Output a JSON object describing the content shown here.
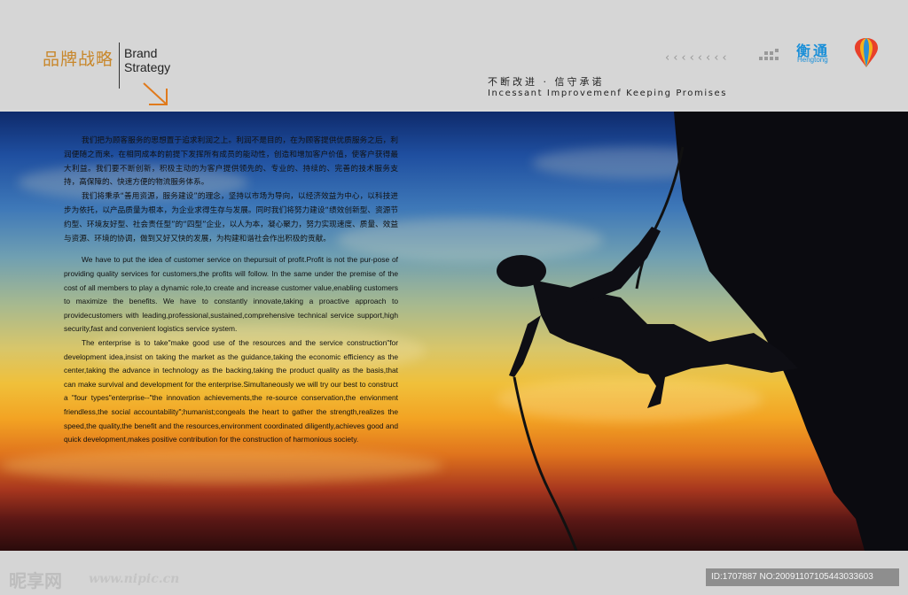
{
  "header": {
    "brand_cn": "品牌战略",
    "brand_en_line1": "Brand",
    "brand_en_line2": "Strategy",
    "chevrons": "‹‹‹‹‹‹‹‹",
    "logo_cn": "衡通",
    "logo_en": "Hengtong",
    "slogan_cn": "不断改进 · 信守承诺",
    "slogan_en": "Incessant Improvemenf Keeping Promises",
    "brand_color": "#c8872b",
    "logo_color": "#1a8fd8"
  },
  "body": {
    "paragraphs_cn": [
      "我们把为顾客服务的思想置于追求利润之上。利润不是目的，在为顾客提供优质服务之后，利润便随之而来。在相同成本的前提下发挥所有成员的能动性，创造和增加客户价值，使客户获得最大利益。我们要不断创新，积极主动的为客户提供领先的、专业的、持续的、完善的技术服务支持，高保障的、快速方便的物流服务体系。",
      "我们将秉承“善用资源，服务建设”的理念，坚持以市场为导向，以经济效益为中心，以科技进步为依托，以产品质量为根本，为企业求得生存与发展。同时我们将努力建设“绩效创新型、资源节约型、环境友好型、社会责任型”的“四型”企业，以人为本，凝心聚力，努力实现速度、质量、效益与资源、环境的协调，做到又好又快的发展，为构建和谐社会作出积极的贡献。"
    ],
    "paragraphs_en": [
      "We have to put the idea of customer service on thepursuit of profit.Profit is not the pur-pose of providing quality services for customers,the profits will follow. In the same under the premise of the cost of all members to play a dynamic role,to create and increase customer value,enabling customers to maximize the benefits. We have to constantly innovate,taking a proactive approach to providecustomers with leading,professional,sustained,comprehensive technical service support,high security,fast and convenient logistics service system.",
      "The enterprise is to take\"make good use of the resources and the service construction\"for development idea,insist on taking the market as the guidance,taking the economic efficiency as the center,taking the advance in technology as the backing,taking the product quality as the basis,that can make survival and development for the enterprise.Simultaneously we will try our best to construct a \"four types\"enterprise--\"the innovation achievements,the re-source conservation,the envionment friendless,the social accountability\";humanist;congeals the heart to gather the strength,realizes the speed,the quality,the benefit and the resources,environment coordinated diligently,achieves good and quick development,makes positive contribution for the construction of harmonious society."
    ]
  },
  "footer": {
    "watermark_logo": "昵享网",
    "watermark_url": "www.nipic.cn",
    "watermark_id": "ID:1707887 NO:20091107105443033603"
  }
}
